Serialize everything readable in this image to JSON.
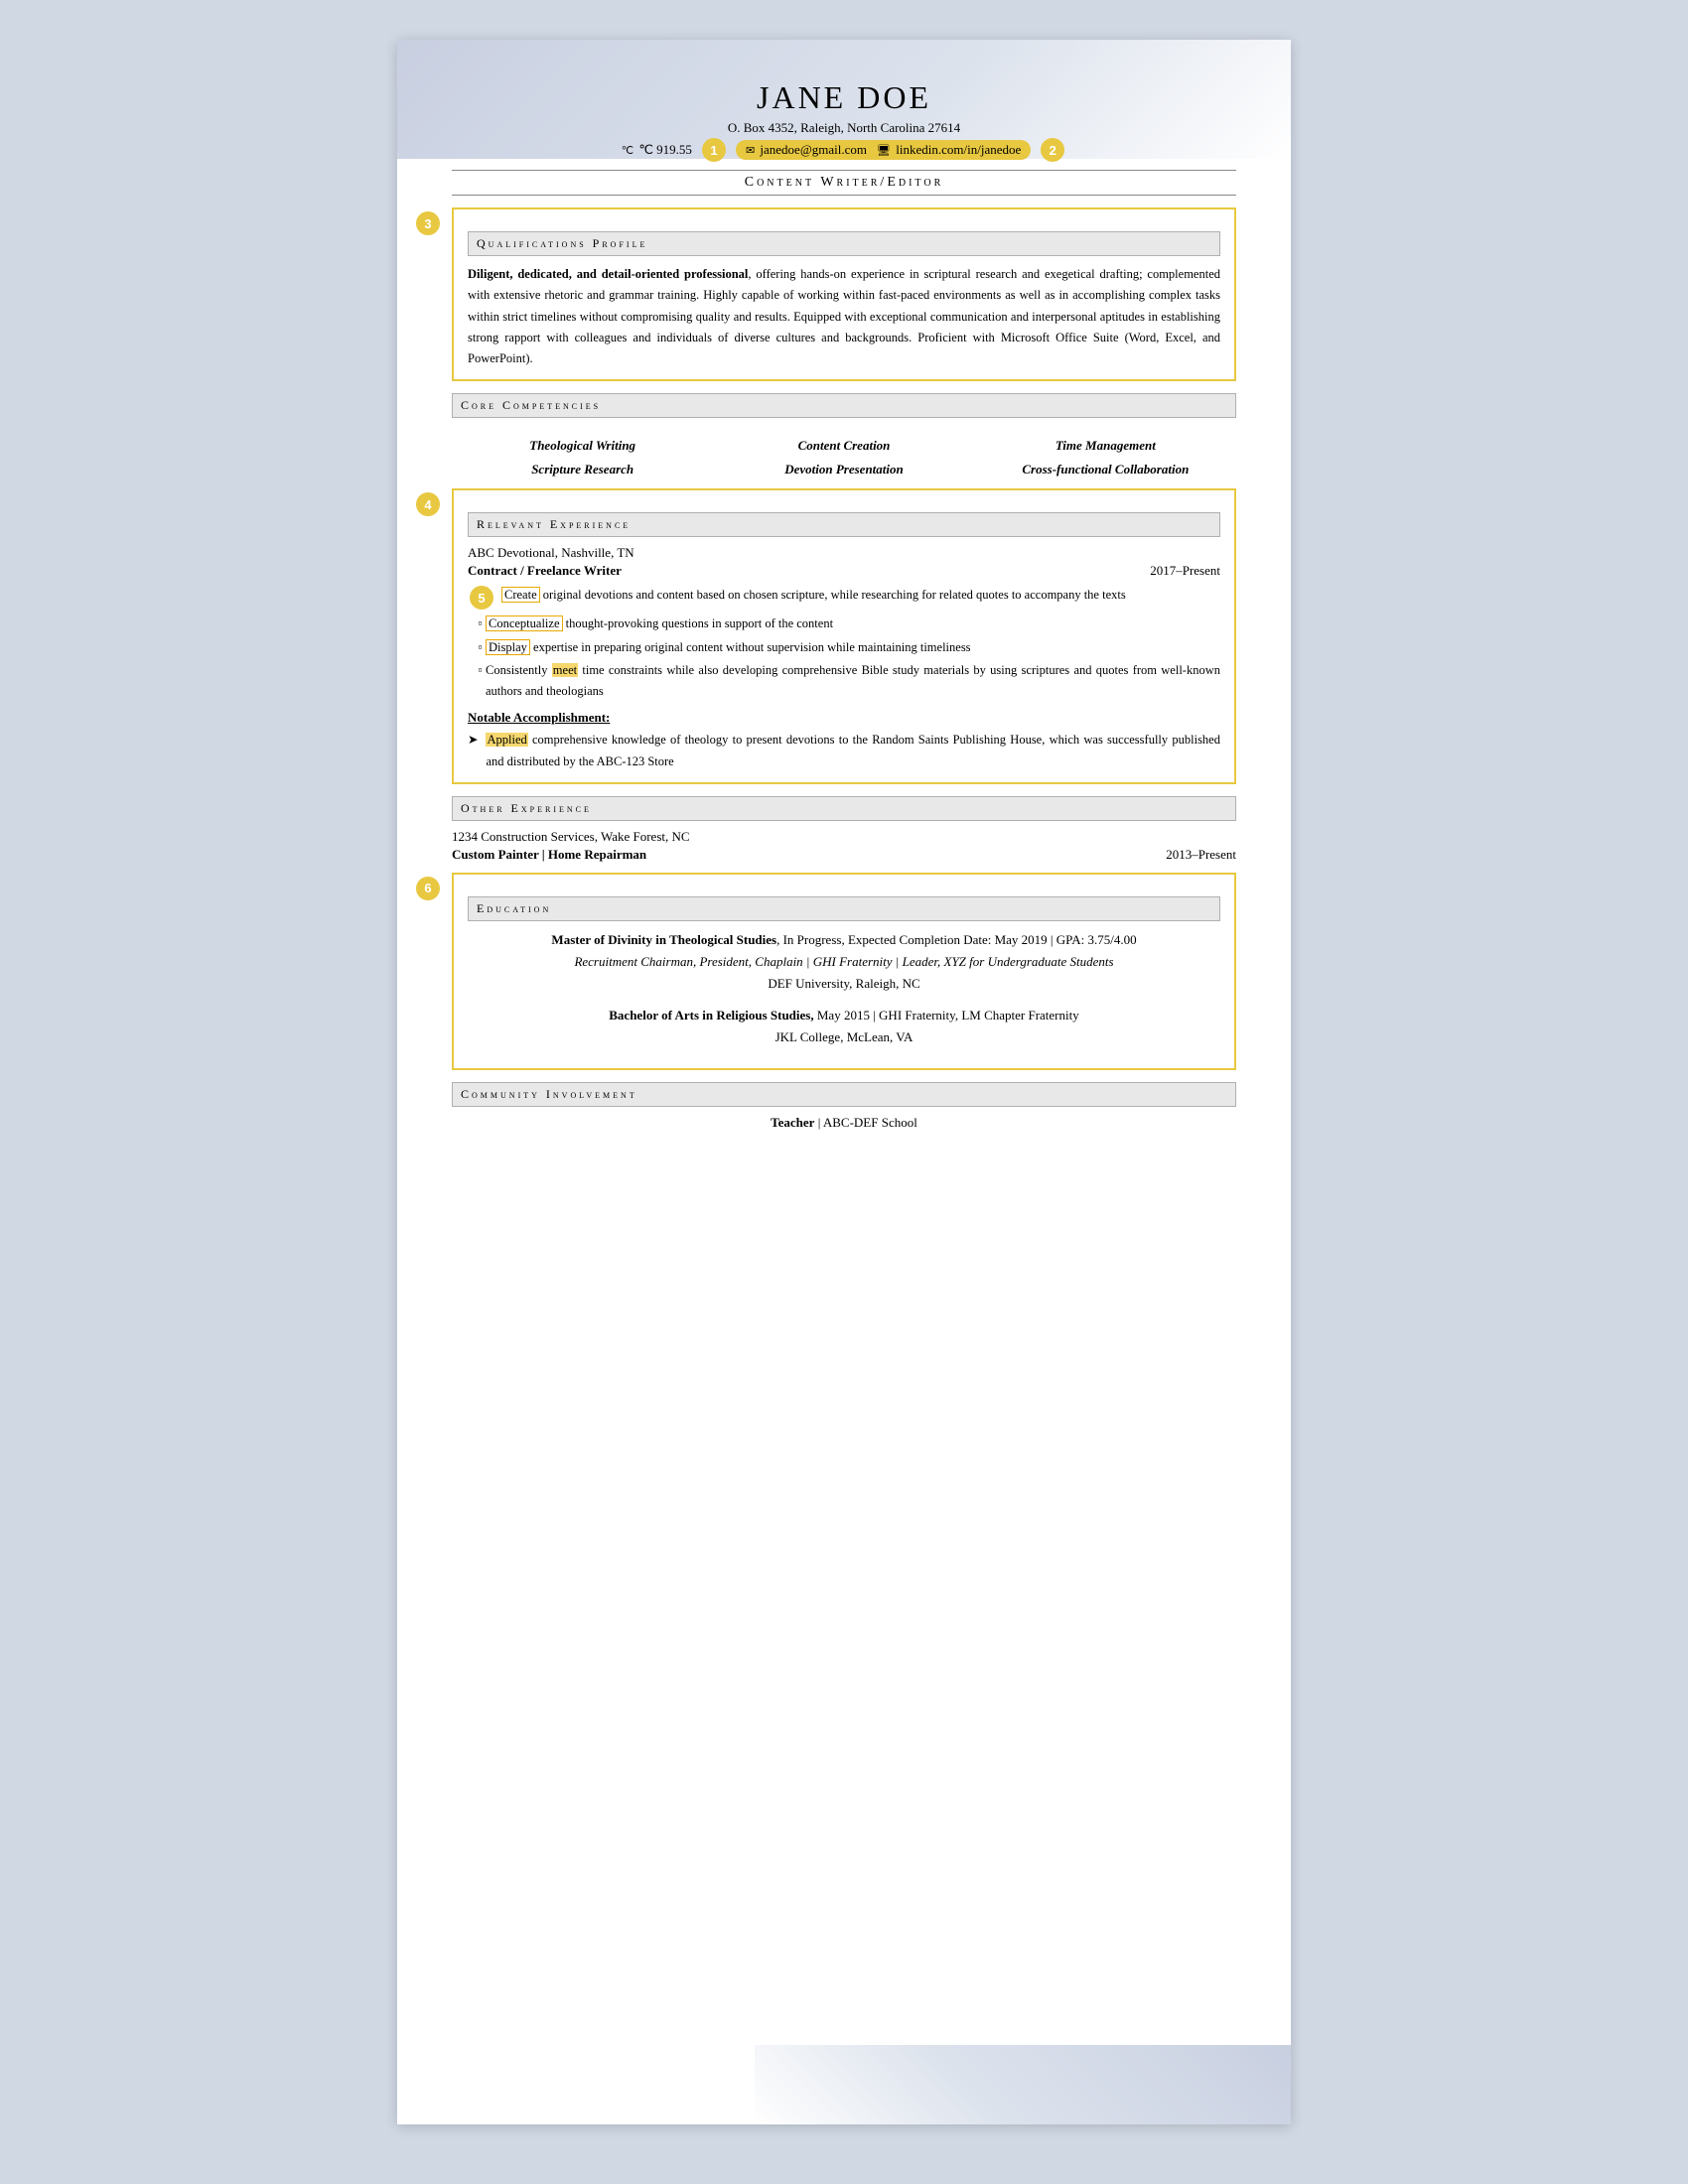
{
  "header": {
    "name": "Jane Doe",
    "address": "O. Box 4352, Raleigh, North Carolina 27614",
    "phone_label": "℃ 919.55",
    "email": "janedoe@gmail.com",
    "linkedin": "linkedin.com/in/janedoe",
    "title": "Content Writer/Editor"
  },
  "badges": {
    "b1": "1",
    "b2": "2",
    "b3": "3",
    "b4": "4",
    "b5": "5",
    "b6": "6"
  },
  "sections": {
    "qualifications_header": "Qualifications Profile",
    "qualifications_text": "Diligent, dedicated, and detail-oriented professional, offering hands-on experience in scriptural research and exegetical drafting; complemented with extensive rhetoric and grammar training. Highly capable of working within fast-paced environments as well as in accomplishing complex tasks within strict timelines without compromising quality and results. Equipped with exceptional communication and interpersonal aptitudes in establishing strong rapport with colleagues and individuals of diverse cultures and backgrounds. Proficient with Microsoft Office Suite (Word, Excel, and PowerPoint).",
    "qualifications_bold": "Diligent, dedicated, and detail-oriented professional",
    "core_header": "Core Competencies",
    "competencies": [
      [
        "Theological Writing",
        "Content Creation",
        "Time Management"
      ],
      [
        "Scripture Research",
        "Devotion Presentation",
        "Cross-functional Collaboration"
      ]
    ],
    "relevant_header": "Relevant Experience",
    "relevant_company": "ABC Devotional, Nashville, TN",
    "relevant_title": "Contract / Freelance Writer",
    "relevant_date": "2017–Present",
    "relevant_bullets": [
      "Create original devotions and content based on chosen scripture, while researching for related quotes to accompany the texts",
      "Conceptualize thought-provoking questions in support of the content",
      "Display expertise in preparing original content without supervision while maintaining timeliness",
      "Consistently meet time constraints while also developing comprehensive Bible study materials by using scriptures and quotes from well-known authors and theologians"
    ],
    "notable_label": "Notable Accomplishment:",
    "notable_text": "Applied comprehensive knowledge of theology to present devotions to the Random Saints Publishing House, which was successfully published and distributed by the ABC-123 Store",
    "other_header": "Other Experience",
    "other_company": "1234 Construction Services, Wake Forest, NC",
    "other_title": "Custom Painter | Home Repairman",
    "other_date": "2013–Present",
    "education_header": "Education",
    "edu1_degree": "Master of Divinity in Theological Studies",
    "edu1_detail": ", In Progress, Expected Completion Date: May 2019 | GPA: 3.75/4.00",
    "edu1_line2": "Recruitment Chairman, President, Chaplain | GHI Fraternity | Leader, XYZ for Undergraduate Students",
    "edu1_school": "DEF University, Raleigh, NC",
    "edu2_degree": "Bachelor of Arts in Religious Studies,",
    "edu2_detail": " May 2015 | GHI Fraternity, LM Chapter Fraternity",
    "edu2_school": "JKL College, McLean, VA",
    "community_header": "Community Involvement",
    "community_line": "Teacher | ABC-DEF School"
  }
}
